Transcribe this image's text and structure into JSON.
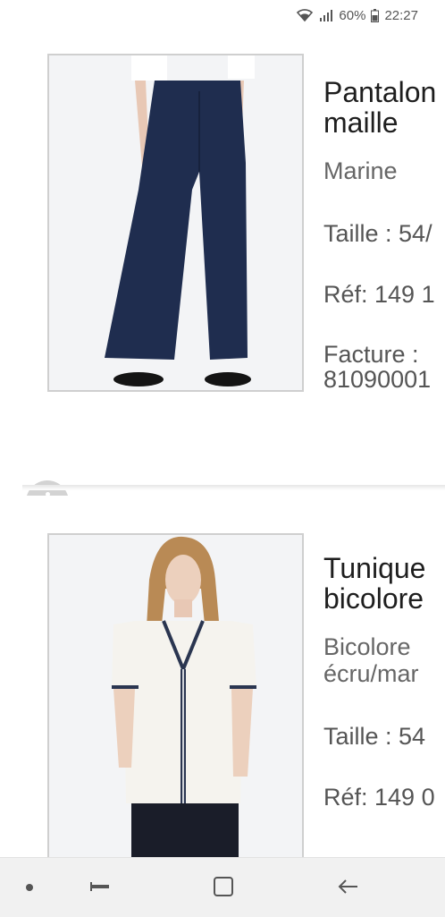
{
  "status_bar": {
    "battery": "60%",
    "time": "22:27",
    "icons": [
      "wifi-icon",
      "signal-icon",
      "battery-icon"
    ]
  },
  "products": [
    {
      "title_line1": "Pantalon",
      "title_line2": "maille",
      "color": "Marine",
      "size": "Taille : 54/",
      "ref": "Réf: 149 1",
      "invoice_label": "Facture :",
      "invoice_number": "81090001"
    },
    {
      "title_line1": "Tunique",
      "title_line2": "bicolore",
      "color_line1": "Bicolore",
      "color_line2": "écru/mar",
      "size": "Taille : 54",
      "ref": "Réf: 149 0"
    }
  ],
  "nav_bar": {
    "icons": [
      "nav-dot-icon",
      "recents-icon",
      "home-icon",
      "back-icon"
    ]
  }
}
